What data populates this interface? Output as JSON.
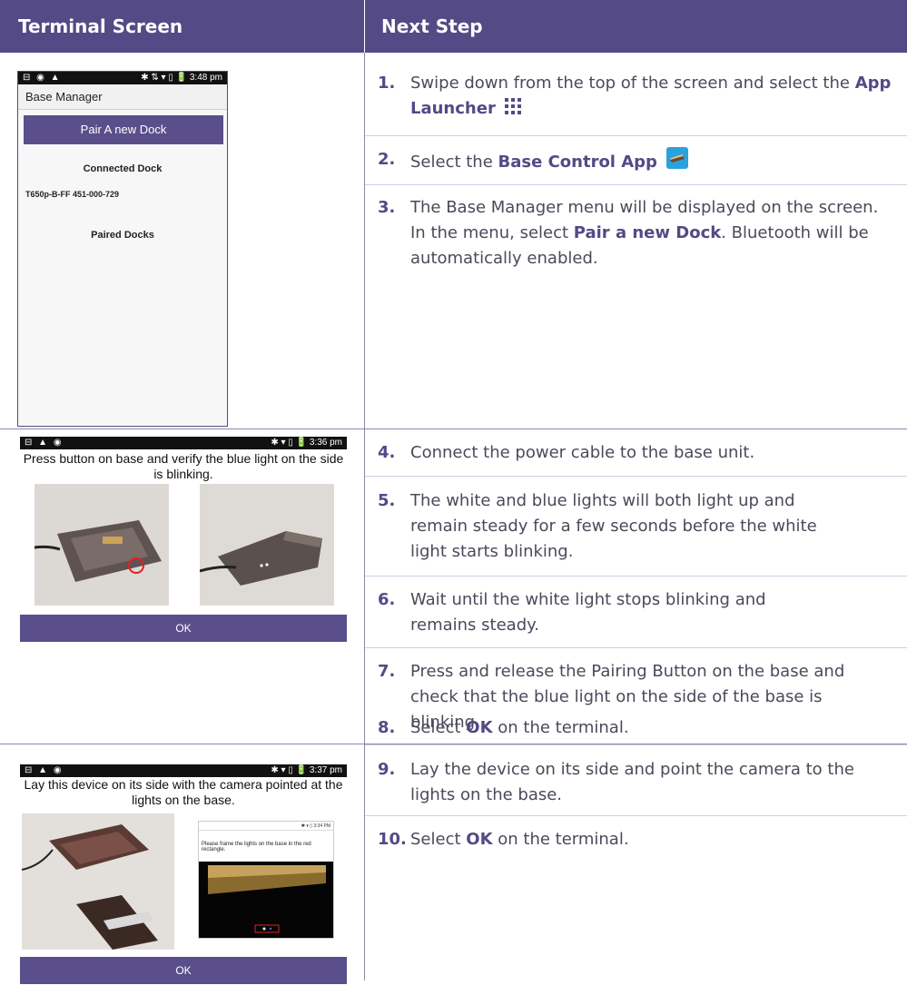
{
  "header": {
    "col1": "Terminal Screen",
    "col2": "Next Step"
  },
  "colors": {
    "brand": "#534a86",
    "text": "#4a4a5a"
  },
  "screen1": {
    "status_left": "⊟ ◉ ▲",
    "status_right": "✱ ⇅ ▾ ▯ 🔋 3:48 pm",
    "title": "Base Manager",
    "pair_button": "Pair A new Dock",
    "connected_label": "Connected Dock",
    "dock_id": "T650p-B-FF 451-000-729",
    "paired_label": "Paired Docks"
  },
  "screen2": {
    "status_left": "⊟ ▲ ◉",
    "status_right": "✱ ▾ ▯ 🔋 3:36 pm",
    "instruction": "Press button on base and verify the blue light on the side is blinking.",
    "ok": "OK"
  },
  "screen3": {
    "status_left": "⊟ ▲ ◉",
    "status_right": "✱ ▾ ▯ 🔋 3:37 pm",
    "instruction": "Lay this device on its side with the camera pointed at the lights on the base.",
    "inner_status": "✱ ▾ ▯ 3:34 PM",
    "inner_text": "Please frame the lights on the base in the red rectangle.",
    "ok": "OK"
  },
  "steps": [
    {
      "num": "1.",
      "pre": "Swipe down from the top of the screen and select the ",
      "bold": "App Launcher",
      "post": ""
    },
    {
      "num": "2.",
      "pre": "Select the ",
      "bold": "Base Control App",
      "post": ""
    },
    {
      "num": "3.",
      "pre": "The Base Manager menu will be displayed on the screen. In the menu, select ",
      "bold": "Pair a new Dock",
      "post": ". Bluetooth will be automatically enabled."
    },
    {
      "num": "4.",
      "text": "Connect the power cable to the base unit."
    },
    {
      "num": "5.",
      "text": "The white and blue lights will both light up and remain steady for a few seconds before the white light starts blinking."
    },
    {
      "num": "6.",
      "text": "Wait until the white light stops blinking and remains steady."
    },
    {
      "num": "7.",
      "text": "Press and release the Pairing Button on the base and check that the blue light on the side of the base is blinking."
    },
    {
      "num": "8.",
      "pre": "Select ",
      "bold": "OK",
      "post": " on the terminal."
    },
    {
      "num": "9.",
      "text": "Lay the device on its side and point the camera to the lights on the base."
    },
    {
      "num": "10.",
      "pre": "Select ",
      "bold": "OK",
      "post": " on the terminal."
    }
  ]
}
